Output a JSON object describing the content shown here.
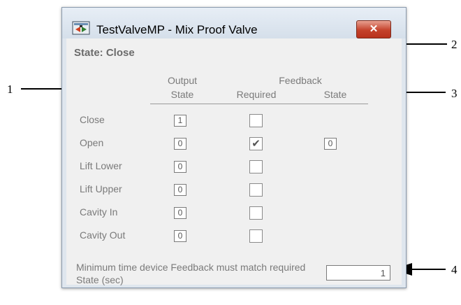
{
  "window": {
    "title": "TestValveMP - Mix Proof Valve",
    "close_glyph": "✕",
    "icon": "valve-app-icon"
  },
  "state_title": "State: Close",
  "headers": {
    "output_line1": "Output",
    "output_line2": "State",
    "feedback_line1": "Feedback",
    "required": "Required",
    "state": "State"
  },
  "rows": [
    {
      "label": "Close",
      "output": "1",
      "required": false
    },
    {
      "label": "Open",
      "output": "0",
      "required": true,
      "feedback_state": "0"
    },
    {
      "label": "Lift Lower",
      "output": "0",
      "required": false
    },
    {
      "label": "Lift Upper",
      "output": "0",
      "required": false
    },
    {
      "label": "Cavity In",
      "output": "0",
      "required": false
    },
    {
      "label": "Cavity Out",
      "output": "0",
      "required": false
    }
  ],
  "min_time": {
    "label": "Minimum time device Feedback must match required State (sec)",
    "value": "1"
  },
  "callouts": [
    "1",
    "2",
    "3",
    "4"
  ],
  "checkmark": "✔"
}
